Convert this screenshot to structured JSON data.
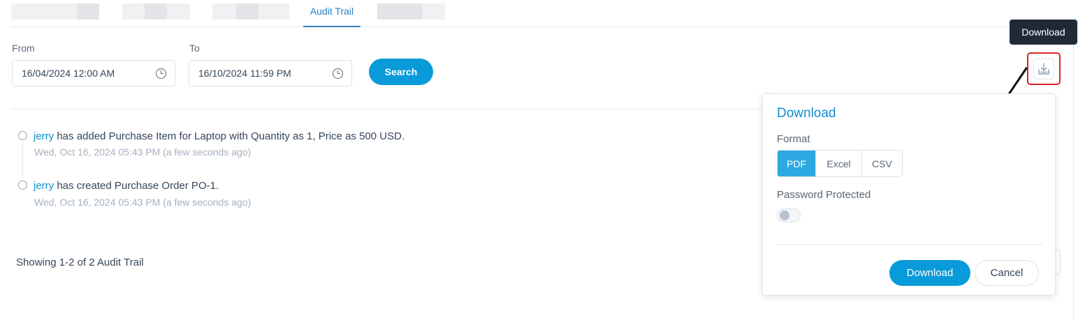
{
  "tabs": {
    "active_label": "Audit Trail"
  },
  "filters": {
    "from_label": "From",
    "from_value": "16/04/2024 12:00 AM",
    "to_label": "To",
    "to_value": "16/10/2024 11:59 PM",
    "search_label": "Search"
  },
  "timeline": [
    {
      "user": "jerry",
      "text": " has added Purchase Item for Laptop with Quantity as 1, Price as 500 USD.",
      "time": "Wed, Oct 16, 2024 05:43 PM (a few seconds ago)"
    },
    {
      "user": "jerry",
      "text": " has created Purchase Order PO-1.",
      "time": "Wed, Oct 16, 2024 05:43 PM (a few seconds ago)"
    }
  ],
  "footer": {
    "showing": "Showing 1-2 of 2 Audit Trail"
  },
  "tooltip": {
    "text": "Download"
  },
  "download_popover": {
    "title": "Download",
    "format_label": "Format",
    "formats": [
      "PDF",
      "Excel",
      "CSV"
    ],
    "selected_format": "PDF",
    "password_label": "Password Protected",
    "password_protected": false,
    "download_label": "Download",
    "cancel_label": "Cancel"
  },
  "colors": {
    "accent": "#099ad9",
    "link": "#0f8ed0",
    "highlight": "#d8232a"
  },
  "icons": [
    "clock-icon",
    "download-icon",
    "annotation-arrow"
  ]
}
